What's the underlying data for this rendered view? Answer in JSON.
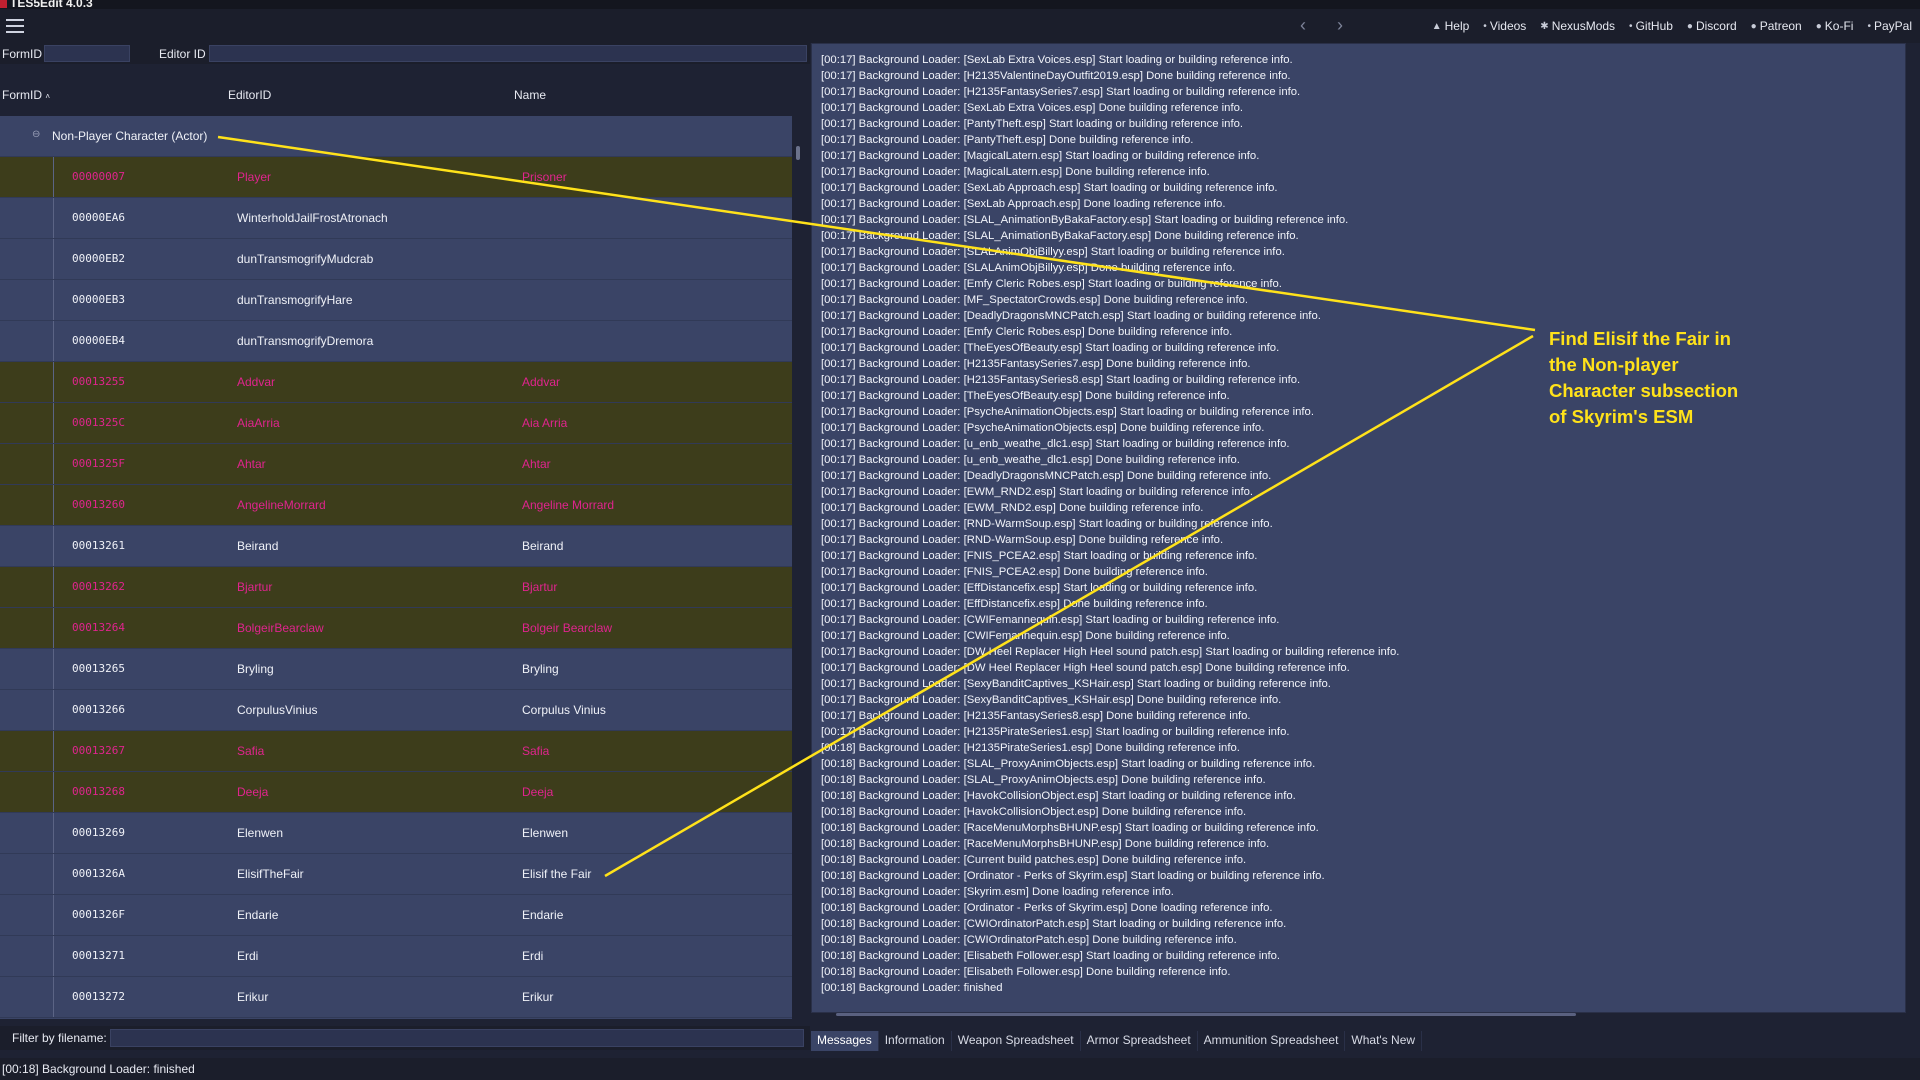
{
  "window": {
    "title": "TES5Edit 4.0.3"
  },
  "toolbar": {
    "links": [
      {
        "icon": "help-icon",
        "glyph": "▲",
        "label": "Help"
      },
      {
        "icon": "videos-icon",
        "glyph": "•",
        "label": "Videos"
      },
      {
        "icon": "nexusmods-icon",
        "glyph": "✱",
        "label": "NexusMods"
      },
      {
        "icon": "github-icon",
        "glyph": "•",
        "label": "GitHub"
      },
      {
        "icon": "discord-icon",
        "glyph": "●",
        "label": "Discord"
      },
      {
        "icon": "patreon-icon",
        "glyph": "●",
        "label": "Patreon"
      },
      {
        "icon": "kofi-icon",
        "glyph": "●",
        "label": "Ko-Fi"
      },
      {
        "icon": "paypal-icon",
        "glyph": "•",
        "label": "PayPal"
      }
    ]
  },
  "search": {
    "formid_label": "FormID",
    "formid_value": "",
    "editorid_label": "Editor ID",
    "editorid_value": ""
  },
  "grid": {
    "headers": {
      "formid": "FormID",
      "sort_glyph": "˄",
      "editorid": "EditorID",
      "name": "Name"
    },
    "group": {
      "label": "Non-Player Character (Actor)",
      "expander": "⊖"
    },
    "rows": [
      {
        "formid": "00000007",
        "editorid": "Player",
        "name": "Prisoner",
        "conflict": true
      },
      {
        "formid": "00000EA6",
        "editorid": "WinterholdJailFrostAtronach",
        "name": "",
        "conflict": false
      },
      {
        "formid": "00000EB2",
        "editorid": "dunTransmogrifyMudcrab",
        "name": "",
        "conflict": false
      },
      {
        "formid": "00000EB3",
        "editorid": "dunTransmogrifyHare",
        "name": "",
        "conflict": false
      },
      {
        "formid": "00000EB4",
        "editorid": "dunTransmogrifyDremora",
        "name": "",
        "conflict": false
      },
      {
        "formid": "00013255",
        "editorid": "Addvar",
        "name": "Addvar",
        "conflict": true
      },
      {
        "formid": "0001325C",
        "editorid": "AiaArria",
        "name": "Aia Arria",
        "conflict": true
      },
      {
        "formid": "0001325F",
        "editorid": "Ahtar",
        "name": "Ahtar",
        "conflict": true
      },
      {
        "formid": "00013260",
        "editorid": "AngelineMorrard",
        "name": "Angeline Morrard",
        "conflict": true
      },
      {
        "formid": "00013261",
        "editorid": "Beirand",
        "name": "Beirand",
        "conflict": false
      },
      {
        "formid": "00013262",
        "editorid": "Bjartur",
        "name": "Bjartur",
        "conflict": true
      },
      {
        "formid": "00013264",
        "editorid": "BolgeirBearclaw",
        "name": "Bolgeir Bearclaw",
        "conflict": true
      },
      {
        "formid": "00013265",
        "editorid": "Bryling",
        "name": "Bryling",
        "conflict": false
      },
      {
        "formid": "00013266",
        "editorid": "CorpulusVinius",
        "name": "Corpulus Vinius",
        "conflict": false
      },
      {
        "formid": "00013267",
        "editorid": "Safia",
        "name": "Safia",
        "conflict": true
      },
      {
        "formid": "00013268",
        "editorid": "Deeja",
        "name": "Deeja",
        "conflict": true
      },
      {
        "formid": "00013269",
        "editorid": "Elenwen",
        "name": "Elenwen",
        "conflict": false
      },
      {
        "formid": "0001326A",
        "editorid": "ElisifTheFair",
        "name": "Elisif the Fair",
        "conflict": false
      },
      {
        "formid": "0001326F",
        "editorid": "Endarie",
        "name": "Endarie",
        "conflict": false
      },
      {
        "formid": "00013271",
        "editorid": "Erdi",
        "name": "Erdi",
        "conflict": false
      },
      {
        "formid": "00013272",
        "editorid": "Erikur",
        "name": "Erikur",
        "conflict": false
      }
    ]
  },
  "filter": {
    "label": "Filter by filename:",
    "value": ""
  },
  "status": {
    "text": "[00:18] Background Loader: finished"
  },
  "messages": [
    "[00:17] Background Loader: [SexLab Extra Voices.esp] Start loading or building reference info.",
    "[00:17] Background Loader: [H2135ValentineDayOutfit2019.esp] Done building reference info.",
    "[00:17] Background Loader: [H2135FantasySeries7.esp] Start loading or building reference info.",
    "[00:17] Background Loader: [SexLab Extra Voices.esp] Done building reference info.",
    "[00:17] Background Loader: [PantyTheft.esp] Start loading or building reference info.",
    "[00:17] Background Loader: [PantyTheft.esp] Done building reference info.",
    "[00:17] Background Loader: [MagicalLatern.esp] Start loading or building reference info.",
    "[00:17] Background Loader: [MagicalLatern.esp] Done building reference info.",
    "[00:17] Background Loader: [SexLab Approach.esp] Start loading or building reference info.",
    "[00:17] Background Loader: [SexLab Approach.esp] Done loading reference info.",
    "[00:17] Background Loader: [SLAL_AnimationByBakaFactory.esp] Start loading or building reference info.",
    "[00:17] Background Loader: [SLAL_AnimationByBakaFactory.esp] Done building reference info.",
    "[00:17] Background Loader: [SLALAnimObjBillyy.esp] Start loading or building reference info.",
    "[00:17] Background Loader: [SLALAnimObjBillyy.esp] Done building reference info.",
    "[00:17] Background Loader: [Emfy Cleric Robes.esp] Start loading or building reference info.",
    "[00:17] Background Loader: [MF_SpectatorCrowds.esp] Done building reference info.",
    "[00:17] Background Loader: [DeadlyDragonsMNCPatch.esp] Start loading or building reference info.",
    "[00:17] Background Loader: [Emfy Cleric Robes.esp] Done building reference info.",
    "[00:17] Background Loader: [TheEyesOfBeauty.esp] Start loading or building reference info.",
    "[00:17] Background Loader: [H2135FantasySeries7.esp] Done building reference info.",
    "[00:17] Background Loader: [H2135FantasySeries8.esp] Start loading or building reference info.",
    "[00:17] Background Loader: [TheEyesOfBeauty.esp] Done building reference info.",
    "[00:17] Background Loader: [PsycheAnimationObjects.esp] Start loading or building reference info.",
    "[00:17] Background Loader: [PsycheAnimationObjects.esp] Done building reference info.",
    "[00:17] Background Loader: [u_enb_weathe_dlc1.esp] Start loading or building reference info.",
    "[00:17] Background Loader: [u_enb_weathe_dlc1.esp] Done building reference info.",
    "[00:17] Background Loader: [DeadlyDragonsMNCPatch.esp] Done building reference info.",
    "[00:17] Background Loader: [EWM_RND2.esp] Start loading or building reference info.",
    "[00:17] Background Loader: [EWM_RND2.esp] Done building reference info.",
    "[00:17] Background Loader: [RND-WarmSoup.esp] Start loading or building reference info.",
    "[00:17] Background Loader: [RND-WarmSoup.esp] Done building reference info.",
    "[00:17] Background Loader: [FNIS_PCEA2.esp] Start loading or building reference info.",
    "[00:17] Background Loader: [FNIS_PCEA2.esp] Done building reference info.",
    "[00:17] Background Loader: [EffDistancefix.esp] Start loading or building reference info.",
    "[00:17] Background Loader: [EffDistancefix.esp] Done building reference info.",
    "[00:17] Background Loader: [CWIFemannequin.esp] Start loading or building reference info.",
    "[00:17] Background Loader: [CWIFemannequin.esp] Done building reference info.",
    "[00:17] Background Loader: [DW Heel Replacer High Heel sound patch.esp] Start loading or building reference info.",
    "[00:17] Background Loader: [DW Heel Replacer High Heel sound patch.esp] Done building reference info.",
    "[00:17] Background Loader: [SexyBanditCaptives_KSHair.esp] Start loading or building reference info.",
    "[00:17] Background Loader: [SexyBanditCaptives_KSHair.esp] Done building reference info.",
    "[00:17] Background Loader: [H2135FantasySeries8.esp] Done building reference info.",
    "[00:17] Background Loader: [H2135PirateSeries1.esp] Start loading or building reference info.",
    "[00:18] Background Loader: [H2135PirateSeries1.esp] Done building reference info.",
    "[00:18] Background Loader: [SLAL_ProxyAnimObjects.esp] Start loading or building reference info.",
    "[00:18] Background Loader: [SLAL_ProxyAnimObjects.esp] Done building reference info.",
    "[00:18] Background Loader: [HavokCollisionObject.esp] Start loading or building reference info.",
    "[00:18] Background Loader: [HavokCollisionObject.esp] Done building reference info.",
    "[00:18] Background Loader: [RaceMenuMorphsBHUNP.esp] Start loading or building reference info.",
    "[00:18] Background Loader: [RaceMenuMorphsBHUNP.esp] Done building reference info.",
    "[00:18] Background Loader: [Current build patches.esp] Done building reference info.",
    "[00:18] Background Loader: [Ordinator - Perks of Skyrim.esp] Start loading or building reference info.",
    "[00:18] Background Loader: [Skyrim.esm] Done loading reference info.",
    "[00:18] Background Loader: [Ordinator - Perks of Skyrim.esp] Done loading reference info.",
    "[00:18] Background Loader: [CWIOrdinatorPatch.esp] Start loading or building reference info.",
    "[00:18] Background Loader: [CWIOrdinatorPatch.esp] Done building reference info.",
    "[00:18] Background Loader: [Elisabeth Follower.esp] Start loading or building reference info.",
    "[00:18] Background Loader: [Elisabeth Follower.esp] Done building reference info.",
    "[00:18] Background Loader: finished"
  ],
  "tabs": [
    "Messages",
    "Information",
    "Weapon Spreadsheet",
    "Armor Spreadsheet",
    "Ammunition Spreadsheet",
    "What's New"
  ],
  "annotation": {
    "text": "Find Elisif the Fair in the Non-player Character subsection of Skyrim's ESM",
    "color": "#ffe21a"
  }
}
